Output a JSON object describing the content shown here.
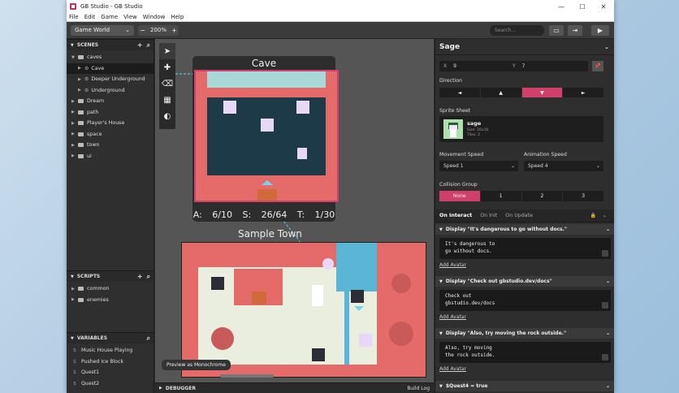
{
  "window": {
    "title": "GB Studio - GB Studio",
    "controls": [
      "—",
      "☐",
      "✕"
    ]
  },
  "menu": [
    "File",
    "Edit",
    "Game",
    "View",
    "Window",
    "Help"
  ],
  "toolbar": {
    "view": "Game World",
    "zoom": "200%",
    "zoom_minus": "−",
    "zoom_plus": "+",
    "search_placeholder": "Search..."
  },
  "scenes": {
    "header": "SCENES",
    "items": [
      {
        "label": "caves",
        "kind": "folder",
        "open": true
      },
      {
        "label": "Cave",
        "kind": "scene",
        "active": true
      },
      {
        "label": "Deeper Underground",
        "kind": "scene"
      },
      {
        "label": "Underground",
        "kind": "scene"
      },
      {
        "label": "Dream",
        "kind": "folder"
      },
      {
        "label": "path",
        "kind": "folder"
      },
      {
        "label": "Player's House",
        "kind": "folder"
      },
      {
        "label": "space",
        "kind": "folder"
      },
      {
        "label": "town",
        "kind": "folder"
      },
      {
        "label": "ui",
        "kind": "folder"
      }
    ]
  },
  "scripts": {
    "header": "SCRIPTS",
    "items": [
      {
        "label": "common"
      },
      {
        "label": "enemies"
      }
    ]
  },
  "variables": {
    "header": "VARIABLES",
    "items": [
      {
        "label": "Music House Playing"
      },
      {
        "label": "Pushed Ice Block"
      },
      {
        "label": "Quest1"
      },
      {
        "label": "Quest2"
      }
    ],
    "prefix": "$"
  },
  "canvas": {
    "cave_title": "Cave",
    "cave_stats": "A: 6/10 S: 26/64 T: 1/30",
    "town_title": "Sample Town",
    "monochrome_button": "Preview as Monochrome"
  },
  "debugger": {
    "label": "DEBUGGER",
    "build_log": "Build Log"
  },
  "actor": {
    "name": "Sage",
    "x_label": "X",
    "x": "9",
    "y_label": "Y",
    "y": "7",
    "direction_label": "Direction",
    "directions": [
      "◄",
      "▲",
      "▼",
      "►"
    ],
    "direction_selected": 2,
    "sprite_sheet_label": "Sprite Sheet",
    "sprite_name": "sage",
    "sprite_size": "Size: 16x16",
    "sprite_tiles": "Tiles: 2",
    "movement_speed_label": "Movement Speed",
    "movement_speed": "Speed 1",
    "animation_speed_label": "Animation Speed",
    "animation_speed": "Speed 4",
    "collision_group_label": "Collision Group",
    "collision_groups": [
      "None",
      "1",
      "2",
      "3"
    ],
    "collision_selected": 0
  },
  "script_tabs": {
    "items": [
      "On Interact",
      "On Init",
      "On Update"
    ],
    "selected": 0
  },
  "events": [
    {
      "title": "Display \"It's dangerous to go without docs.\"",
      "text": "It's dangerous to\ngo without docs.",
      "add": "Add Avatar"
    },
    {
      "title": "Display \"Check out gbstudio.dev/docs\"",
      "text": "Check out\ngbstudio.dev/docs",
      "add": "Add Avatar"
    },
    {
      "title": "Display \"Also, try moving the rock outside.\"",
      "text": "Also, try moving\nthe rock outside.",
      "add": "Add Avatar"
    },
    {
      "title": "$Quest4 = true"
    }
  ],
  "colors": {
    "accent": "#d0406a",
    "cave_bg": "#1d3a48",
    "town_ground": "#e9eedf",
    "town_red": "#e56b6b",
    "water": "#59b6d6"
  }
}
